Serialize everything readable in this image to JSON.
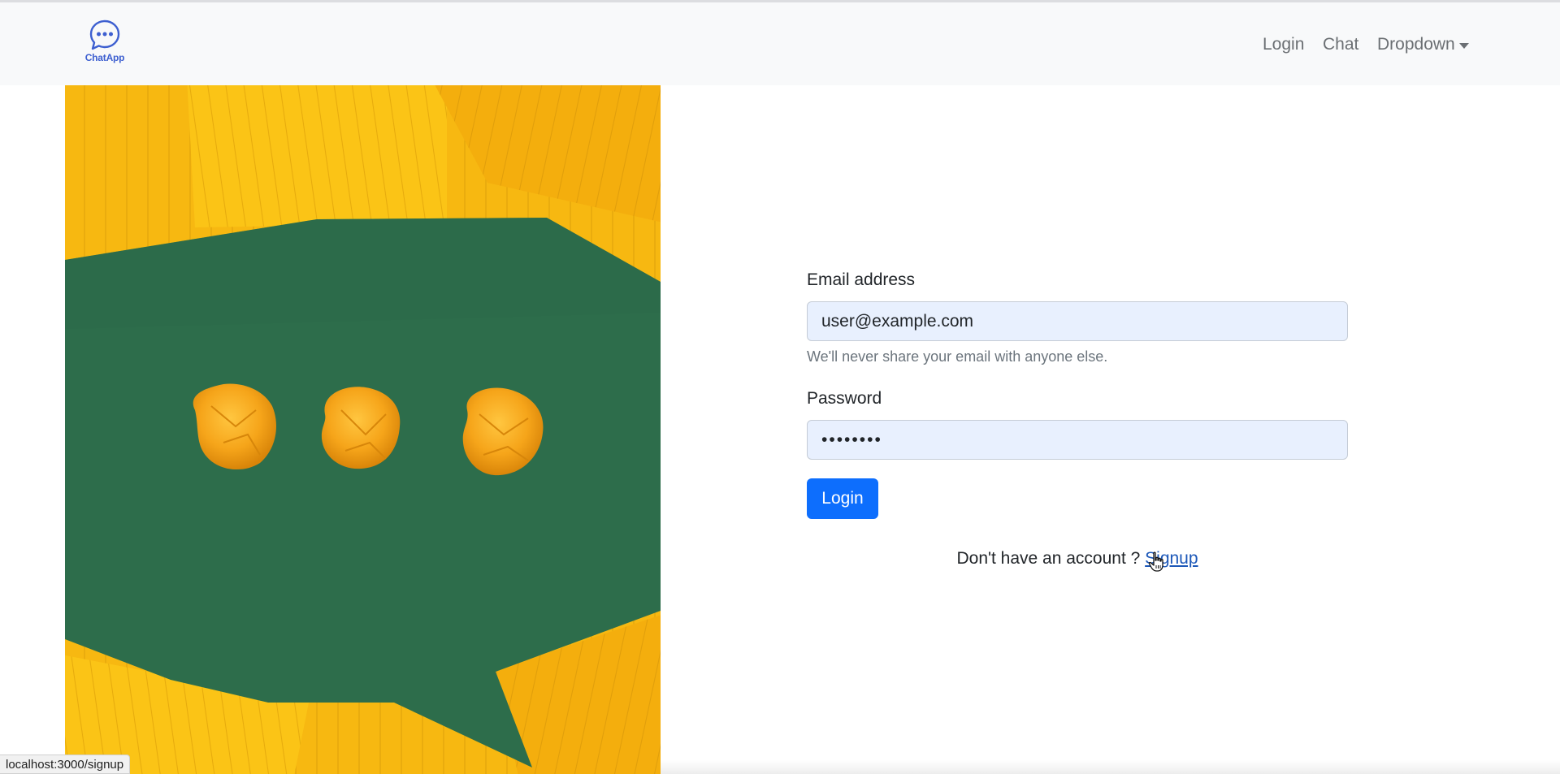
{
  "brand": {
    "name": "ChatApp",
    "icon": "chat-bubble-dots-icon",
    "color": "#3d5fd0"
  },
  "nav": {
    "login": "Login",
    "chat": "Chat",
    "dropdown": "Dropdown"
  },
  "hero": {
    "icon": "paper-speech-bubble-image"
  },
  "form": {
    "email_label": "Email address",
    "email_value": "user@example.com",
    "email_help": "We'll never share your email with anyone else.",
    "password_label": "Password",
    "password_value": "••••••••",
    "submit_label": "Login",
    "no_account_text": "Don't have an account ? ",
    "signup_link": "Signup"
  },
  "status_url": "localhost:3000/signup",
  "colors": {
    "primary": "#0d6efd",
    "navbar_bg": "#f8f9fa",
    "input_autofill_bg": "#e8f0fe",
    "link": "#1b57b8"
  }
}
